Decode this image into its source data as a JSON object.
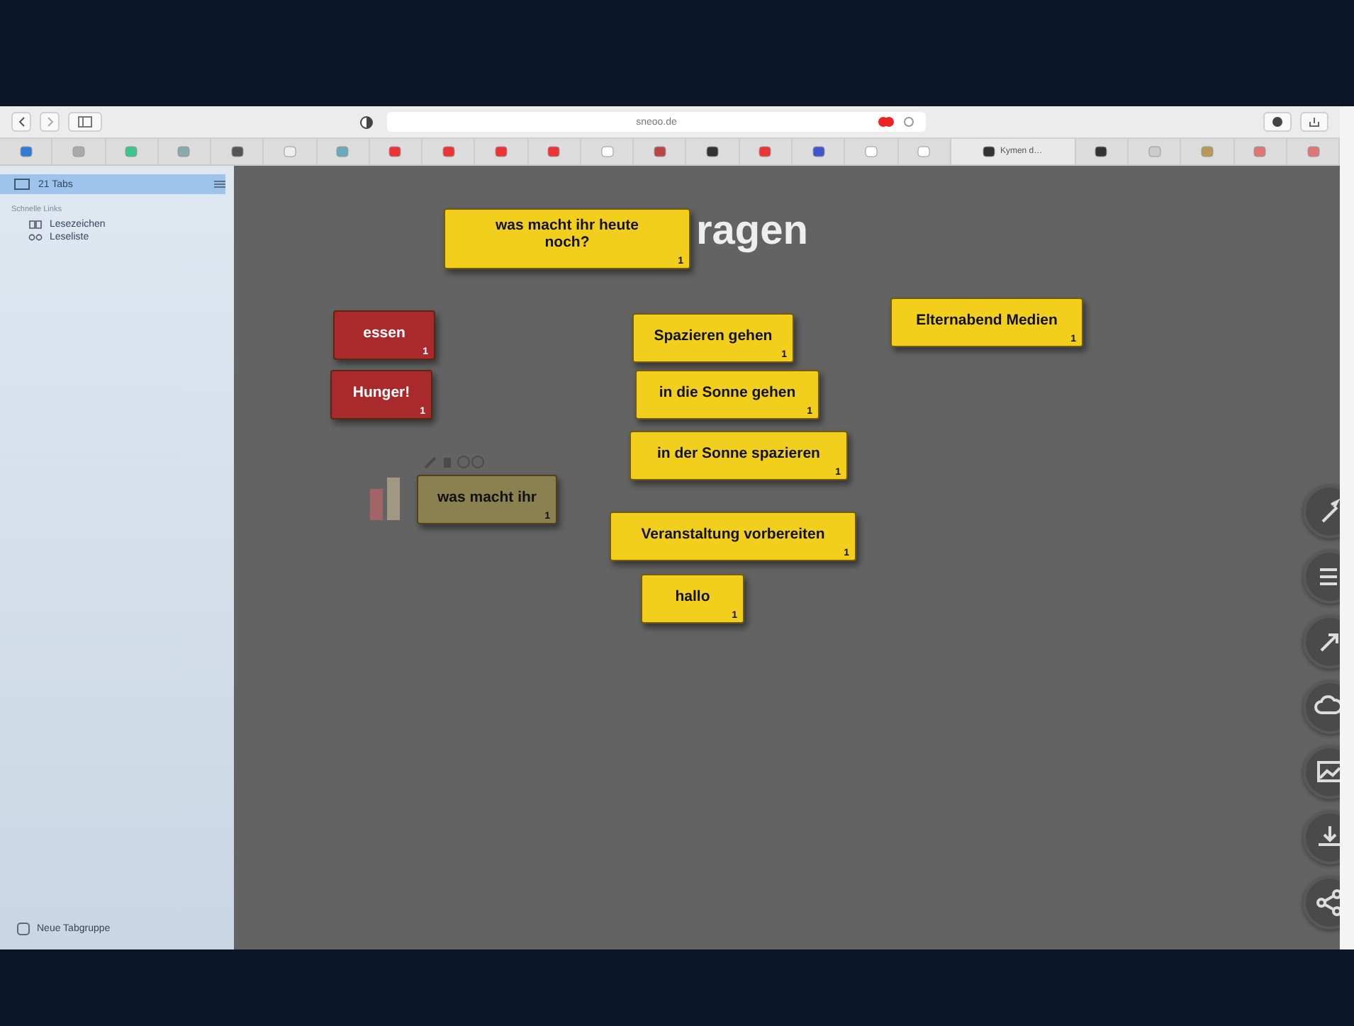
{
  "toolbar": {
    "address": "sneoo.de"
  },
  "tab_strip": {
    "labeled_tab": "Kymen d…"
  },
  "sidebar": {
    "items": [
      {
        "label": "21 Tabs",
        "selected": true
      }
    ],
    "section_title": "Schnelle Links",
    "links": [
      {
        "label": "Lesezeichen",
        "kind": "book"
      },
      {
        "label": "Leseliste",
        "kind": "glasses"
      }
    ],
    "new_group": "Neue Tabgruppe"
  },
  "board": {
    "title_fragment": "ragen",
    "notes": [
      {
        "text": "was macht ihr heute noch?",
        "count": "1",
        "color": "#f2cf1d",
        "kind": "note"
      },
      {
        "text": "essen",
        "count": "1",
        "color": "#a82a2c",
        "kind": "note"
      },
      {
        "text": "Hunger!",
        "count": "1",
        "color": "#a82a2c",
        "kind": "note"
      },
      {
        "text": "Spazieren gehen",
        "count": "1",
        "color": "#f2cf1d",
        "kind": "note"
      },
      {
        "text": "in die Sonne gehen",
        "count": "1",
        "color": "#f2cf1d",
        "kind": "note"
      },
      {
        "text": "in der Sonne spazieren",
        "count": "1",
        "color": "#f2cf1d",
        "kind": "note"
      },
      {
        "text": "Veranstaltung vorbereiten",
        "count": "1",
        "color": "#f2cf1d",
        "kind": "note"
      },
      {
        "text": "hallo",
        "count": "1",
        "color": "#f2cf1d",
        "kind": "note"
      },
      {
        "text": "Elternabend Medien",
        "count": "1",
        "color": "#f2cf1d",
        "kind": "note"
      },
      {
        "text": "was macht ihr",
        "count": "1",
        "color": "#8a8050",
        "kind": "ghost"
      }
    ]
  }
}
